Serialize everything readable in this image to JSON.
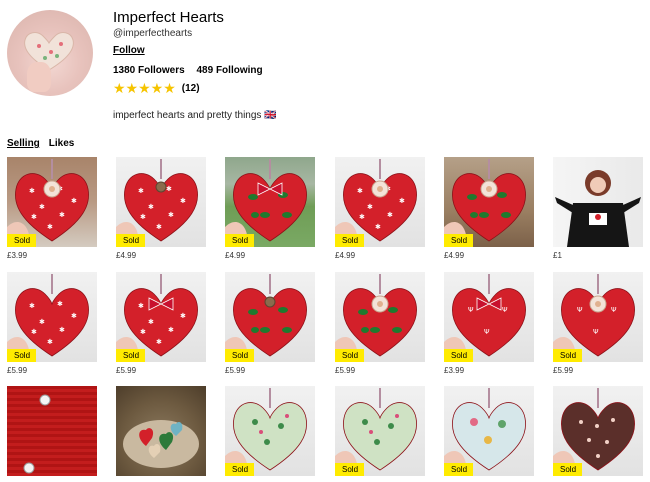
{
  "profile": {
    "name": "Imperfect Hearts",
    "handle": "@imperfecthearts",
    "follow_label": "Follow",
    "followers": "1380 Followers",
    "following": "489 Following",
    "stars": "★★★★★",
    "rating_count": "(12)",
    "bio": "imperfect hearts and pretty things",
    "bio_extra": "🇬🇧"
  },
  "tabs": [
    {
      "label": "Selling",
      "active": true
    },
    {
      "label": "Likes",
      "active": false
    }
  ],
  "colors": {
    "star": "#f6c400",
    "sold_badge": "#ffeb00",
    "heart_red": "#d3202a"
  },
  "items": [
    {
      "badge": "Sold",
      "price": "£3.99",
      "bg": "fence",
      "art": "heart-white-stars-rose"
    },
    {
      "badge": "Sold",
      "price": "£4.99",
      "bg": "wall",
      "art": "heart-white-stars-button"
    },
    {
      "badge": "Sold",
      "price": "£4.99",
      "bg": "grass",
      "art": "heart-holly-bow"
    },
    {
      "badge": "Sold",
      "price": "£4.99",
      "bg": "wall",
      "art": "heart-snowflake-flower"
    },
    {
      "badge": "Sold",
      "price": "£4.99",
      "bg": "room",
      "art": "heart-holly-flower"
    },
    {
      "badge": "",
      "price": "£1",
      "bg": "door",
      "art": "person-christmas-jumper"
    },
    {
      "badge": "Sold",
      "price": "£5.99",
      "bg": "wall",
      "art": "heart-white-stars"
    },
    {
      "badge": "Sold",
      "price": "£5.99",
      "bg": "wall",
      "art": "heart-white-stars-ribbon"
    },
    {
      "badge": "Sold",
      "price": "£5.99",
      "bg": "wall",
      "art": "heart-holly-button"
    },
    {
      "badge": "Sold",
      "price": "£5.99",
      "bg": "wall",
      "art": "heart-holly-flower"
    },
    {
      "badge": "Sold",
      "price": "£3.99",
      "bg": "wall",
      "art": "heart-reindeer-gingham"
    },
    {
      "badge": "Sold",
      "price": "£5.99",
      "bg": "wall",
      "art": "heart-reindeer-rose"
    },
    {
      "badge": "",
      "price": "",
      "bg": "knit",
      "art": "knitted-red-button"
    },
    {
      "badge": "",
      "price": "",
      "bg": "basket",
      "art": "basket-of-hearts"
    },
    {
      "badge": "Sold",
      "price": "",
      "bg": "wall",
      "art": "heart-green-floral"
    },
    {
      "badge": "Sold",
      "price": "",
      "bg": "wall",
      "art": "heart-green-print"
    },
    {
      "badge": "Sold",
      "price": "",
      "bg": "wall",
      "art": "heart-multi-floral"
    },
    {
      "badge": "Sold",
      "price": "",
      "bg": "wall",
      "art": "heart-brown-polka"
    }
  ]
}
